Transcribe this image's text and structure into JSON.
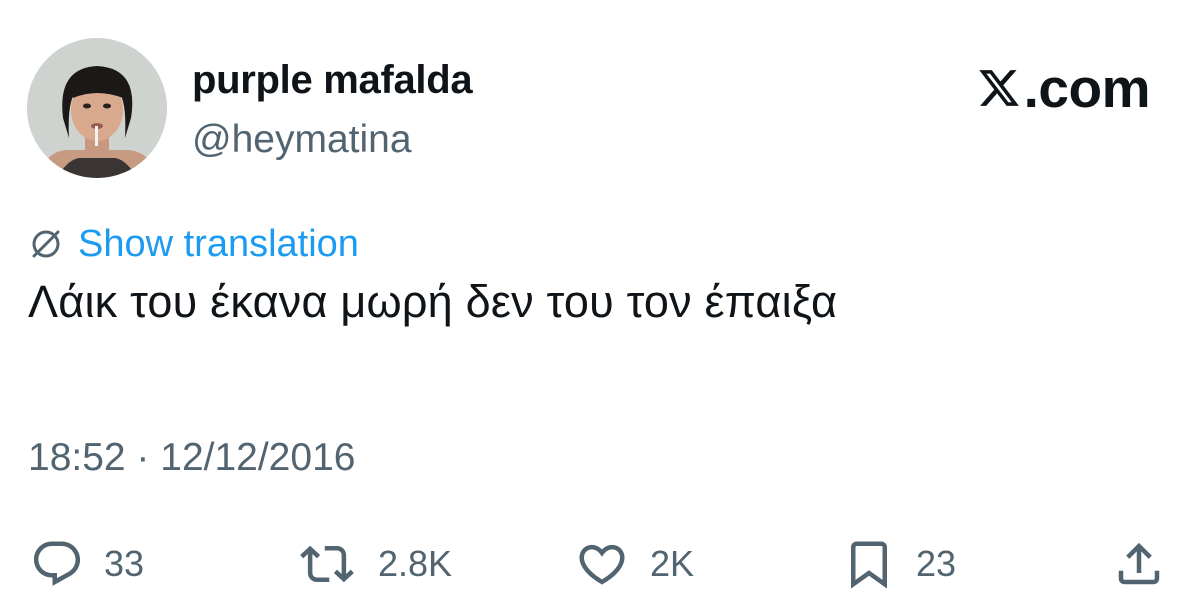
{
  "author": {
    "display_name": "purple mafalda",
    "handle": "@heymatina",
    "avatar_icon": "profile-photo"
  },
  "brand": {
    "label": ".com",
    "logo_icon": "x-logo-icon"
  },
  "translate": {
    "icon": "globe-slash-icon",
    "label": "Show translation",
    "color": "#1d9bf0"
  },
  "tweet": {
    "text": "Λάικ του έκανα μωρή δεν του τον έπαιξα",
    "timestamp": "18:52 · 12/12/2016"
  },
  "actions": {
    "replies": {
      "icon": "reply-icon",
      "count": "33"
    },
    "reposts": {
      "icon": "repost-icon",
      "count": "2.8K"
    },
    "likes": {
      "icon": "heart-icon",
      "count": "2K"
    },
    "bookmarks": {
      "icon": "bookmark-icon",
      "count": "23"
    },
    "share": {
      "icon": "share-icon"
    }
  },
  "colors": {
    "text": "#0f1419",
    "secondary": "#536471",
    "accent": "#1d9bf0"
  }
}
